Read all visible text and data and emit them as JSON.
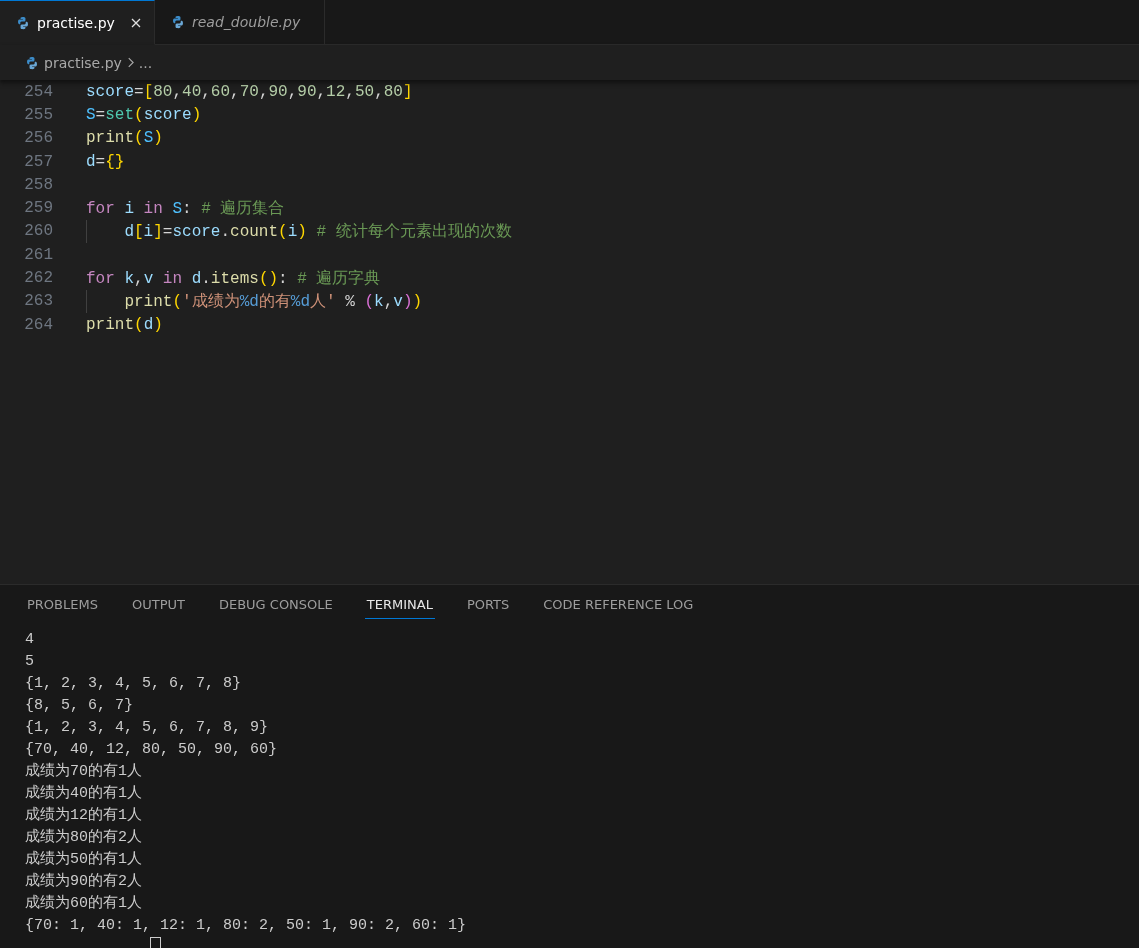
{
  "tabs": [
    {
      "label": "practise.py",
      "selected": true,
      "preview": false
    },
    {
      "label": "read_double.py",
      "selected": false,
      "preview": true
    }
  ],
  "breadcrumb": {
    "file": "practise.py",
    "more": "..."
  },
  "code_lines": [
    {
      "number": "254",
      "tokens": [
        {
          "t": "score",
          "kind": "var"
        },
        {
          "t": "=",
          "kind": "op"
        },
        {
          "t": "[",
          "kind": "b1"
        },
        {
          "t": "80",
          "kind": "num"
        },
        {
          "t": ",",
          "kind": "op"
        },
        {
          "t": "40",
          "kind": "num"
        },
        {
          "t": ",",
          "kind": "op"
        },
        {
          "t": "60",
          "kind": "num"
        },
        {
          "t": ",",
          "kind": "op"
        },
        {
          "t": "70",
          "kind": "num"
        },
        {
          "t": ",",
          "kind": "op"
        },
        {
          "t": "90",
          "kind": "num"
        },
        {
          "t": ",",
          "kind": "op"
        },
        {
          "t": "90",
          "kind": "num"
        },
        {
          "t": ",",
          "kind": "op"
        },
        {
          "t": "12",
          "kind": "num"
        },
        {
          "t": ",",
          "kind": "op"
        },
        {
          "t": "50",
          "kind": "num"
        },
        {
          "t": ",",
          "kind": "op"
        },
        {
          "t": "80",
          "kind": "num"
        },
        {
          "t": "]",
          "kind": "b1"
        }
      ]
    },
    {
      "number": "255",
      "tokens": [
        {
          "t": "S",
          "kind": "const"
        },
        {
          "t": "=",
          "kind": "op"
        },
        {
          "t": "set",
          "kind": "func2"
        },
        {
          "t": "(",
          "kind": "b1"
        },
        {
          "t": "score",
          "kind": "var"
        },
        {
          "t": ")",
          "kind": "b1"
        }
      ]
    },
    {
      "number": "256",
      "tokens": [
        {
          "t": "print",
          "kind": "func"
        },
        {
          "t": "(",
          "kind": "b1"
        },
        {
          "t": "S",
          "kind": "const"
        },
        {
          "t": ")",
          "kind": "b1"
        }
      ]
    },
    {
      "number": "257",
      "tokens": [
        {
          "t": "d",
          "kind": "var"
        },
        {
          "t": "=",
          "kind": "op"
        },
        {
          "t": "{}",
          "kind": "b1"
        }
      ]
    },
    {
      "number": "258"
    },
    {
      "number": "259",
      "tokens": [
        {
          "t": "for ",
          "kind": "kw"
        },
        {
          "t": "i ",
          "kind": "var"
        },
        {
          "t": "in ",
          "kind": "kw"
        },
        {
          "t": "S",
          "kind": "const"
        },
        {
          "t": ": ",
          "kind": "op"
        },
        {
          "t": "# 遍历集合",
          "kind": "comment"
        }
      ],
      "children": [
        {
          "number": "260",
          "tokens": [
            {
              "t": "d",
              "kind": "var"
            },
            {
              "t": "[",
              "kind": "b1"
            },
            {
              "t": "i",
              "kind": "var"
            },
            {
              "t": "]",
              "kind": "b1"
            },
            {
              "t": "=",
              "kind": "op"
            },
            {
              "t": "score",
              "kind": "var"
            },
            {
              "t": ".",
              "kind": "op"
            },
            {
              "t": "count",
              "kind": "func"
            },
            {
              "t": "(",
              "kind": "b1"
            },
            {
              "t": "i",
              "kind": "var"
            },
            {
              "t": ")",
              "kind": "b1"
            },
            {
              "t": " # 统计每个元素出现的次数",
              "kind": "comment"
            }
          ]
        }
      ]
    },
    {
      "number": "261"
    },
    {
      "number": "262",
      "tokens": [
        {
          "t": "for ",
          "kind": "kw"
        },
        {
          "t": "k",
          "kind": "var"
        },
        {
          "t": ",",
          "kind": "op"
        },
        {
          "t": "v ",
          "kind": "var"
        },
        {
          "t": "in ",
          "kind": "kw"
        },
        {
          "t": "d",
          "kind": "var"
        },
        {
          "t": ".",
          "kind": "op"
        },
        {
          "t": "items",
          "kind": "func"
        },
        {
          "t": "()",
          "kind": "b1"
        },
        {
          "t": ": ",
          "kind": "op"
        },
        {
          "t": "# 遍历字典",
          "kind": "comment"
        }
      ],
      "children": [
        {
          "number": "263",
          "tokens": [
            {
              "t": "print",
              "kind": "func"
            },
            {
              "t": "(",
              "kind": "b1"
            },
            {
              "t": "'成绩为",
              "kind": "str"
            },
            {
              "t": "%d",
              "kind": "fmt"
            },
            {
              "t": "的有",
              "kind": "str"
            },
            {
              "t": "%d",
              "kind": "fmt"
            },
            {
              "t": "人'",
              "kind": "str"
            },
            {
              "t": " % ",
              "kind": "op"
            },
            {
              "t": "(",
              "kind": "b2"
            },
            {
              "t": "k",
              "kind": "var"
            },
            {
              "t": ",",
              "kind": "op"
            },
            {
              "t": "v",
              "kind": "var"
            },
            {
              "t": ")",
              "kind": "b2"
            },
            {
              "t": ")",
              "kind": "b1"
            }
          ]
        }
      ]
    },
    {
      "number": "264",
      "tokens": [
        {
          "t": "print",
          "kind": "func"
        },
        {
          "t": "(",
          "kind": "b1"
        },
        {
          "t": "d",
          "kind": "var"
        },
        {
          "t": ")",
          "kind": "b1"
        }
      ]
    }
  ],
  "panel_tabs": [
    {
      "label": "PROBLEMS",
      "selected": false
    },
    {
      "label": "OUTPUT",
      "selected": false
    },
    {
      "label": "DEBUG CONSOLE",
      "selected": false
    },
    {
      "label": "TERMINAL",
      "selected": true
    },
    {
      "label": "PORTS",
      "selected": false
    },
    {
      "label": "CODE REFERENCE LOG",
      "selected": false
    }
  ],
  "terminal_lines": [
    "4",
    "5",
    "{1, 2, 3, 4, 5, 6, 7, 8}",
    "{8, 5, 6, 7}",
    "{1, 2, 3, 4, 5, 6, 7, 8, 9}",
    "{70, 40, 12, 80, 50, 90, 60}",
    "成绩为70的有1人",
    "成绩为40的有1人",
    "成绩为12的有1人",
    "成绩为80的有2人",
    "成绩为50的有1人",
    "成绩为90的有2人",
    "成绩为60的有1人",
    "{70: 1, 40: 1, 12: 1, 80: 2, 50: 1, 90: 2, 60: 1}"
  ]
}
